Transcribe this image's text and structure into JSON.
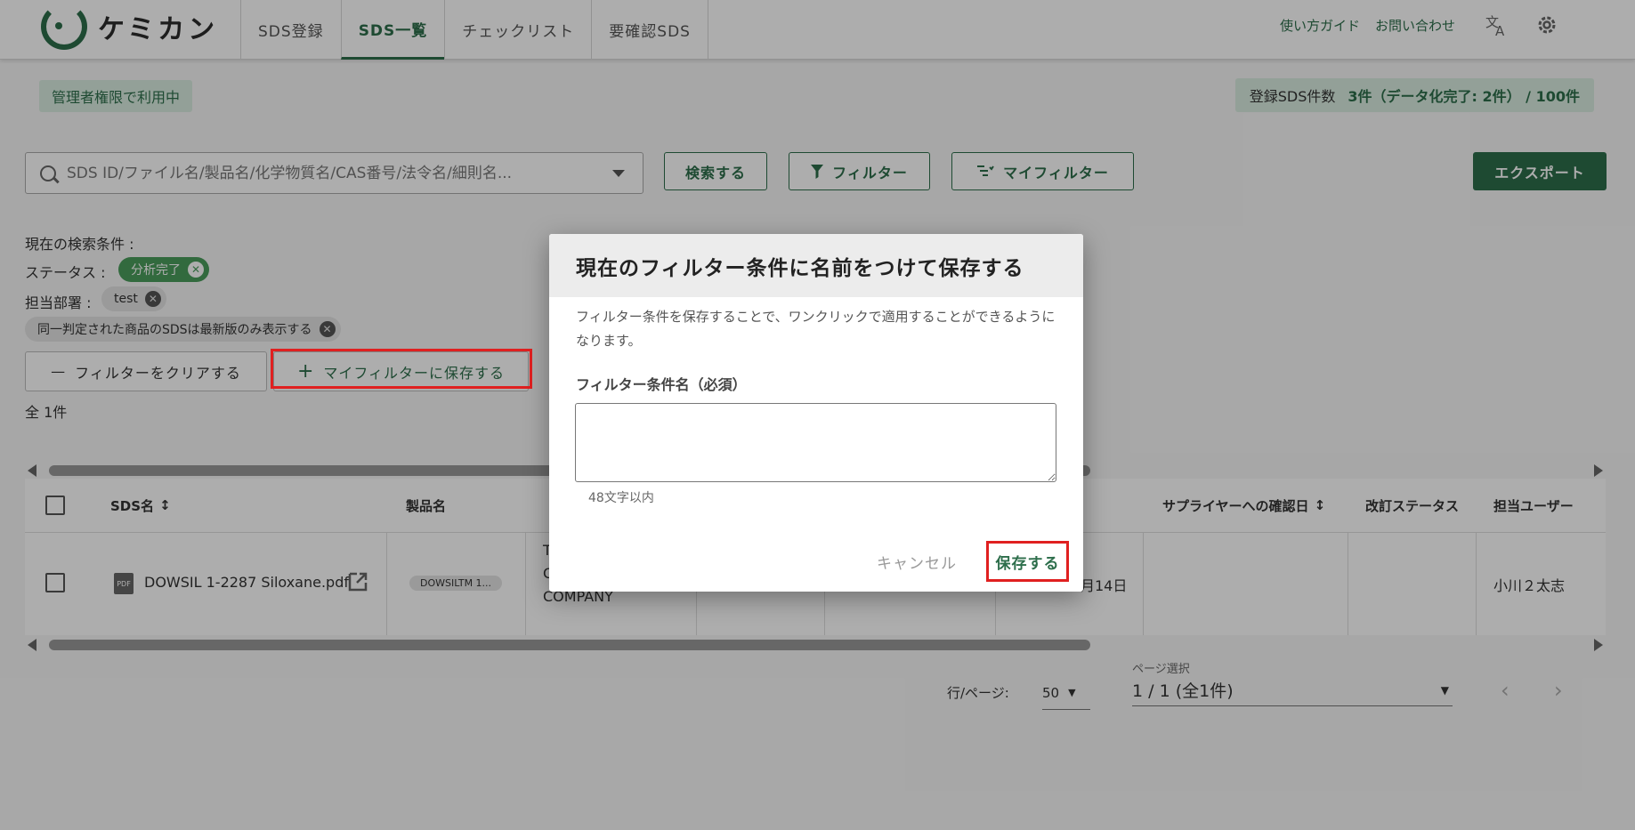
{
  "app": {
    "logo_text": "ケミカン"
  },
  "nav": {
    "tabs": [
      {
        "label": "SDS登録"
      },
      {
        "label": "SDS一覧"
      },
      {
        "label": "チェックリスト"
      },
      {
        "label": "要確認SDS"
      }
    ],
    "guide_link": "使い方ガイド",
    "contact_link": "お問い合わせ"
  },
  "status": {
    "admin_badge": "管理者権限で利用中",
    "count_label": "登録SDS件数",
    "count_value": "3件（データ化完了: 2件） / 100件"
  },
  "search": {
    "placeholder": "SDS ID/ファイル名/製品名/化学物質名/CAS番号/法令名/細則名...",
    "search_button": "検索する",
    "filter_button": "フィルター",
    "my_filter_button": "マイフィルター",
    "export_button": "エクスポート"
  },
  "conditions": {
    "heading": "現在の検索条件 :",
    "status_label": "ステータス :",
    "status_chip": "分析完了",
    "dept_label": "担当部署 :",
    "dept_chip": "test",
    "latest_chip": "同一判定された商品のSDSは最新版のみ表示する",
    "clear_button": "フィルターをクリアする",
    "save_my_filter_button": "マイフィルターに保存する",
    "total": "全 1件"
  },
  "table": {
    "headers": {
      "sds_name": "SDS名",
      "product_name": "製品名",
      "supplier_confirm_date": "サプライヤーへの確認日",
      "revision_status": "改訂ステータス",
      "owner": "担当ユーザー"
    },
    "rows": [
      {
        "file_name": "DOWSIL 1-2287 Siloxane.pdf",
        "product_chip": "DOWSILTM 1...",
        "maker_partial": "T\nC\nCOMPANY",
        "date_partial": "月14日",
        "owner": "小川２太志"
      }
    ]
  },
  "pagination": {
    "rows_per_page_label": "行/ページ:",
    "rows_per_page_value": "50",
    "page_select_label": "ページ選択",
    "page_select_value": "1 / 1 (全1件)"
  },
  "modal": {
    "title": "現在のフィルター条件に名前をつけて保存する",
    "description": "フィルター条件を保存することで、ワンクリックで適用することができるようになります。",
    "field_label": "フィルター条件名（必須）",
    "field_value": "",
    "field_hint": "48文字以内",
    "cancel_button": "キャンセル",
    "save_button": "保存する"
  },
  "colors": {
    "brand": "#2d6e4b",
    "chip_green": "#4a9c5c",
    "highlight": "#e02020"
  }
}
